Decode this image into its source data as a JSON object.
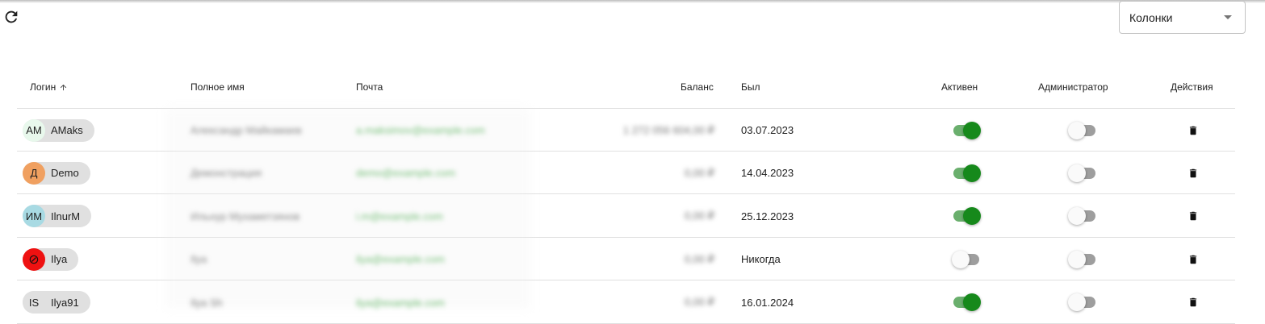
{
  "toolbar": {
    "refresh_icon": "refresh-icon",
    "columns_label": "Колонки",
    "columns_icon": "caret-down-icon"
  },
  "table": {
    "headers": {
      "login": "Логин",
      "full_name": "Полное имя",
      "email": "Почта",
      "balance": "Баланс",
      "last_seen": "Был",
      "active": "Активен",
      "admin": "Администратор",
      "actions": "Действия"
    },
    "sort": {
      "column": "login",
      "direction": "asc",
      "icon": "arrow-up-icon"
    },
    "rows": [
      {
        "avatar_text": "АМ",
        "avatar_color": "#e8f8ec",
        "login": "AMaks",
        "full_name": "Александр Майкамаев",
        "email": "a.maksimov@example.com",
        "balance": "1 272 056 604,00 ₽",
        "last_seen": "03.07.2023",
        "active": true,
        "admin": false
      },
      {
        "avatar_text": "Д",
        "avatar_color": "#f0a060",
        "login": "Demo",
        "full_name": "Демонстрация",
        "email": "demo@example.com",
        "balance": "0,00 ₽",
        "last_seen": "14.04.2023",
        "active": true,
        "admin": false
      },
      {
        "avatar_text": "ИМ",
        "avatar_color": "#a8dae3",
        "login": "IlnurM",
        "full_name": "Ильнур Мухаметзянов",
        "email": "i.m@example.com",
        "balance": "0,00 ₽",
        "last_seen": "25.12.2023",
        "active": true,
        "admin": false
      },
      {
        "avatar_text": "⊘",
        "avatar_color": "#ee1111",
        "login": "Ilya",
        "full_name": "Ilya",
        "email": "ilya@example.com",
        "balance": "0,00 ₽",
        "last_seen": "Никогда",
        "active": false,
        "admin": false
      },
      {
        "avatar_text": "IS",
        "avatar_color": "#e0e0e0",
        "login": "Ilya91",
        "full_name": "Ilya Sh",
        "email": "ilya@example.com",
        "balance": "0,00 ₽",
        "last_seen": "16.01.2024",
        "active": true,
        "admin": false
      }
    ],
    "delete_icon": "trash-icon"
  }
}
